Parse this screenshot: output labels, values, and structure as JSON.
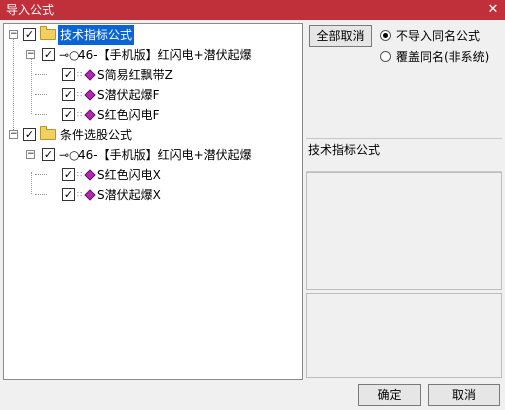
{
  "window": {
    "title": "导入公式",
    "close_glyph": "✕"
  },
  "tree": {
    "groups": [
      {
        "label": "技术指标公式",
        "checked": true,
        "selected": true,
        "formula": {
          "label": "46-【手机版】红闪电+潜伏起爆",
          "checked": true,
          "children": [
            {
              "label": "S简易红飘带Z",
              "checked": true
            },
            {
              "label": "S潜伏起爆F",
              "checked": true
            },
            {
              "label": "S红色闪电F",
              "checked": true
            }
          ]
        }
      },
      {
        "label": "条件选股公式",
        "checked": true,
        "selected": false,
        "formula": {
          "label": "46-【手机版】红闪电+潜伏起爆",
          "checked": true,
          "children": [
            {
              "label": "S红色闪电X",
              "checked": true
            },
            {
              "label": "S潜伏起爆X",
              "checked": true
            }
          ]
        }
      }
    ],
    "expand_glyph": "−",
    "check_glyph": "✓",
    "key_glyph": "⊸○",
    "dots_glyph": "∷"
  },
  "buttons": {
    "all_cancel": "全部取消",
    "ok": "确定",
    "cancel": "取消"
  },
  "options": {
    "no_import_same": "不导入同名公式",
    "overwrite_same": "覆盖同名(非系统)",
    "selected": "no_import_same"
  },
  "info_panel": {
    "title": "技术指标公式"
  }
}
